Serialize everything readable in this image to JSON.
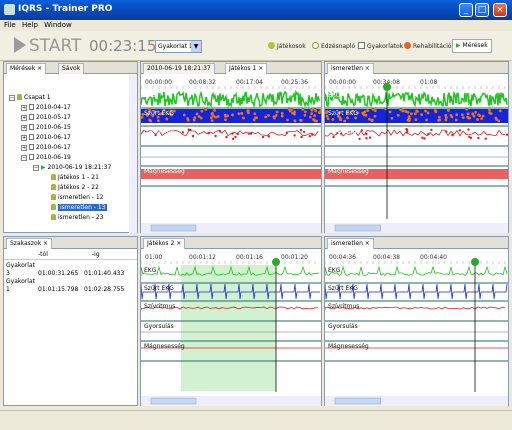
{
  "window": {
    "title": "IQRS - Trainer PRO"
  },
  "menu": [
    "File",
    "Help",
    "Window"
  ],
  "toolbar": {
    "start_label": "START",
    "timer": "00:23:15",
    "exercise_select": "Gyakorlat 1",
    "items": [
      "Játékosok",
      "Edzésnapló",
      "Gyakorlatok",
      "Rehabilitáció"
    ],
    "measure_button": "Mérések"
  },
  "tree_panel": {
    "tabs": [
      "Mérések",
      "Sávok"
    ],
    "root": "Csapat 1",
    "dates": [
      "2010-04-17",
      "2010-05-17",
      "2010-06-15",
      "2010-06-17",
      "2010-06-17",
      "2010-06-19"
    ],
    "session": "2010-06-19 18:21:37",
    "players": [
      "Játékos 1 - 21",
      "Játékos 2 - 22",
      "ismeretlen - 12",
      "ismeretlen - 13",
      "ismeretlen - 23"
    ],
    "selected": "ismeretlen - 13"
  },
  "phases_panel": {
    "tab": "Szakaszok",
    "headers": [
      "",
      "-tól",
      "-ig"
    ],
    "rows": [
      [
        "Gyakorlat 3",
        "01:00:31.265",
        "01:01:40.433"
      ],
      [
        "Gyakorlat 1",
        "01:01:15.798",
        "01:02:28.755"
      ]
    ]
  },
  "signal_labels": [
    "EKG",
    "Szűrt EKG",
    "Szívritmus",
    "Gyorsulás",
    "Mágnesesség"
  ],
  "chart_top_left": {
    "tabs": [
      "2010-06-19 18:21:37",
      "Játékos 1"
    ],
    "ticks": [
      "00:00:00",
      "00:08:32",
      "00:17:04",
      "00:25:36"
    ]
  },
  "chart_top_right": {
    "tabs": [
      "ismeretlen"
    ],
    "ticks": [
      "00:00:00",
      "00:34:08",
      "01:08"
    ]
  },
  "chart_bottom_left": {
    "tabs": [
      "Játékos 2"
    ],
    "ticks": [
      "01:00",
      "00:01:12",
      "00:01:16",
      "00:01:20"
    ]
  },
  "chart_bottom_right": {
    "tabs": [
      "ismeretlen"
    ],
    "ticks": [
      "00:04:36",
      "00:04:38",
      "00:04:40"
    ]
  }
}
